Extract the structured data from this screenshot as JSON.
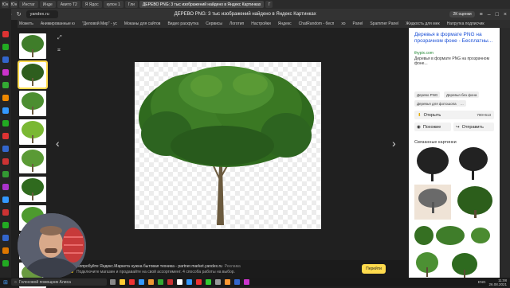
{
  "browser": {
    "tabs": [
      {
        "label": "Юн",
        "active": false
      },
      {
        "label": "Юн",
        "active": false
      },
      {
        "label": "Инстаг",
        "active": false
      },
      {
        "label": "Инде",
        "active": false
      },
      {
        "label": "Авито Т2",
        "active": false
      },
      {
        "label": "Я Ядос",
        "active": false
      },
      {
        "label": "купон 1",
        "active": false
      },
      {
        "label": "Гли",
        "active": false
      },
      {
        "label": "ДЕРЕВО PNG: 3 тыс изображений найдено в Яндекс Картинках",
        "active": true
      },
      {
        "label": "Г",
        "active": false
      }
    ],
    "url": "yandex.ru",
    "page_title": "ДЕРЕВО PNG: 3 тыс изображений найдено в Яндекс Картинках",
    "downloads_badge": "2К оценки",
    "bookmarks": [
      "Можеть",
      "Анимированные ю",
      "\"Деловой Мир\" - ус",
      "Моканы для сайтов",
      "Видео раскрутка",
      "Сервисы",
      "Логотип",
      "Настройки",
      "Яндекс",
      "ChatRandom - бесп",
      "хо",
      "Panel",
      "Spammer Panel",
      "Жидкость для мек",
      "Напрутка подписчик"
    ]
  },
  "viewer": {
    "prev_arrow": "‹",
    "next_arrow": "›",
    "expand_icon": "expand-icon",
    "crop_icon": "crop-icon"
  },
  "panel": {
    "title": "Деревья в формате PNG на прозрачном фоне - Бесплатны...",
    "site": "thypix.com",
    "description": "Деревья в формате PNG на прозрачном фоне...",
    "tags": [
      "Дерево PNG",
      "Деревья без фона",
      "Деревья для фотошопа",
      "..."
    ],
    "open_label": "Открыть",
    "size": "700×613",
    "similar_label": "Похожие",
    "send_label": "Отправить",
    "related_label": "Связанные картинки"
  },
  "promo": {
    "line1": "Попробуйте Яндекс.Маркета нужна бытовая техника - partner.market.yandex.ru",
    "ad": "Реклама",
    "line2": "Подключите магазин и продавайте на свой ассортимент. 4 способа работы на выбор.",
    "button": "Перейти"
  },
  "taskbar": {
    "search_placeholder": "Голосовой помощник Алиса",
    "lang": "ENG",
    "time": "11:08",
    "date": "26.08.2021"
  },
  "colors": {
    "accent": "#ffdb4d",
    "link": "#1a4fd6",
    "tree_dark": "#2f6a1e",
    "tree_light": "#5a9a35"
  }
}
